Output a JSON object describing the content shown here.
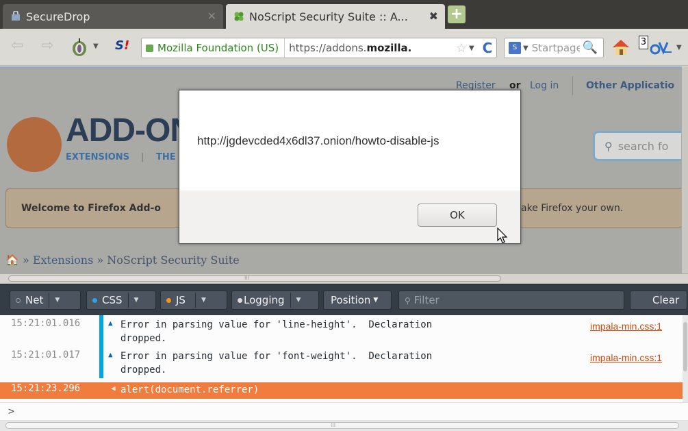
{
  "tabs": [
    {
      "title": "SecureDrop",
      "close": "✕"
    },
    {
      "title": "NoScript Security Suite :: A...",
      "close": "✖"
    }
  ],
  "new_tab_label": "+",
  "navbar": {
    "identity": "Mozilla Foundation (US)",
    "url_prefix": "https://addons.",
    "url_domain": "mozilla.",
    "search_placeholder": "Startpage",
    "tor_badge": "3"
  },
  "page": {
    "register_link": "Register",
    "or_text": "or",
    "login_link": "Log in",
    "other_apps": "Other Applicatio",
    "title": "ADD-ON",
    "subnav_extensions": "EXTENSIONS",
    "subnav_themes": "THE",
    "search_placeholder": "search fo",
    "welcome_left": "Welcome to Firefox Add-o",
    "welcome_right": "ake Firefox your own.",
    "breadcrumb_sep": "»",
    "breadcrumb_extensions": "Extensions",
    "breadcrumb_current": "NoScript Security Suite",
    "hscroll_grip": "III"
  },
  "modal": {
    "message": "http://jgdevcded4x6dl37.onion/howto-disable-js",
    "ok_label": "OK"
  },
  "console": {
    "toolbar": {
      "net": "Net",
      "css": "CSS",
      "js": "JS",
      "logging": "Logging",
      "position": "Position",
      "filter_placeholder": "Filter",
      "clear": "Clear"
    },
    "messages": [
      {
        "timestamp": "15:21:01.016",
        "text": "Error in parsing value for 'line-height'.  Declaration\ndropped.",
        "source": "impala-min.css:1"
      },
      {
        "timestamp": "15:21:01.017",
        "text": "Error in parsing value for 'font-weight'.  Declaration\ndropped.",
        "source": "impala-min.css:1"
      },
      {
        "timestamp": "15:21:23.296",
        "text": "alert(document.referrer)"
      }
    ],
    "prompt": ">",
    "bottom_grip": "III"
  },
  "colors": {
    "net_dot": "#9aa2aa",
    "css_dot": "#2ea3e8",
    "js_dot": "#f2961b",
    "logging_dot": "#dcdcdc",
    "selected_row": "#f07c3e"
  }
}
